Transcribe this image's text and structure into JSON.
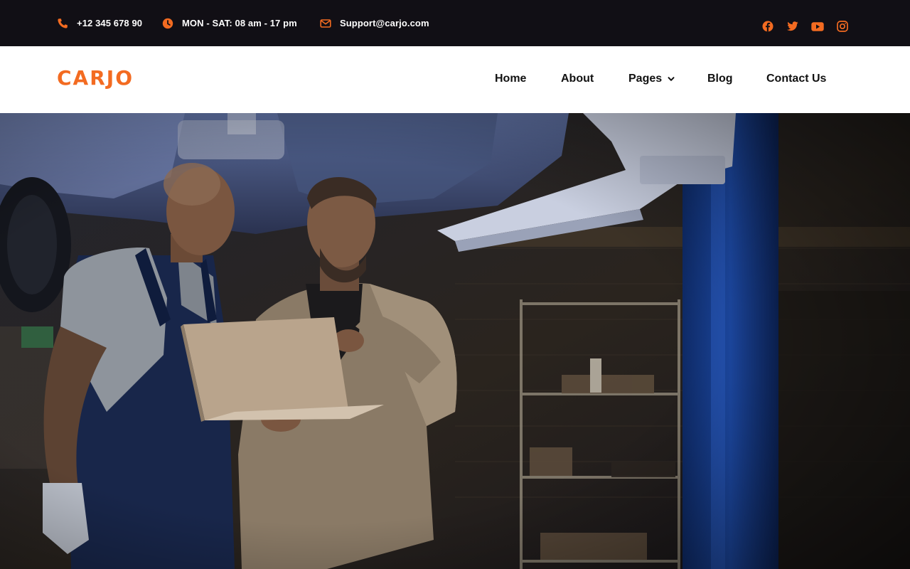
{
  "topbar": {
    "phone": "+12 345 678 90",
    "hours": "MON - SAT: 08 am - 17 pm",
    "email": "Support@carjo.com",
    "icons": [
      "phone-icon",
      "clock-icon",
      "envelope-icon"
    ],
    "social": [
      "facebook-icon",
      "twitter-icon",
      "youtube-icon",
      "instagram-icon"
    ]
  },
  "header": {
    "logo": "CARJO",
    "nav": [
      {
        "label": "Home"
      },
      {
        "label": "About"
      },
      {
        "label": "Pages",
        "has_dropdown": true
      },
      {
        "label": "Blog"
      },
      {
        "label": "Contact Us"
      }
    ]
  },
  "colors": {
    "accent": "#f36b21",
    "topbar_bg": "#110f15",
    "header_bg": "#ffffff"
  },
  "hero": {
    "image": "two mechanics looking at a laptop under a lifted car in a garage"
  }
}
